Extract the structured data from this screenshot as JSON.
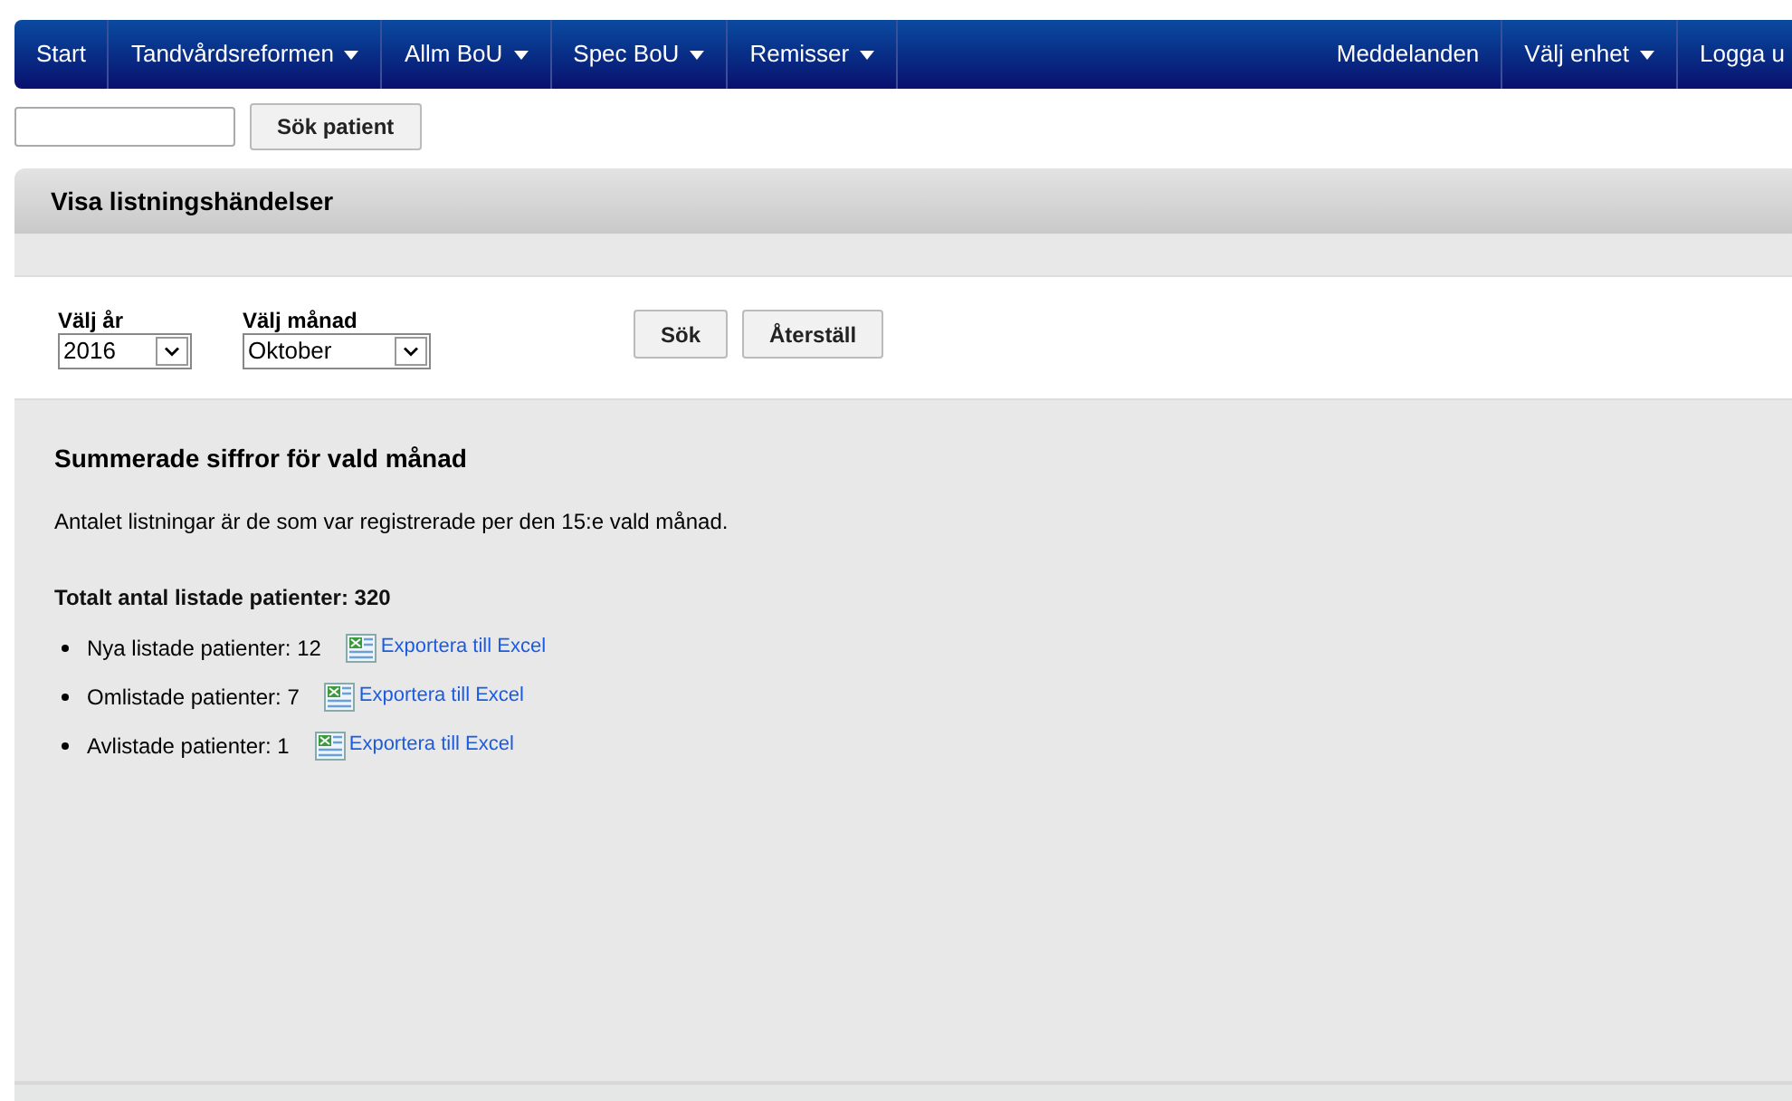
{
  "nav": {
    "left": [
      {
        "label": "Start",
        "dropdown": false
      },
      {
        "label": "Tandvårdsreformen",
        "dropdown": true
      },
      {
        "label": "Allm BoU",
        "dropdown": true
      },
      {
        "label": "Spec BoU",
        "dropdown": true
      },
      {
        "label": "Remisser",
        "dropdown": true
      }
    ],
    "right": [
      {
        "label": "Meddelanden",
        "dropdown": false
      },
      {
        "label": "Välj enhet",
        "dropdown": true
      },
      {
        "label": "Logga u",
        "dropdown": false
      }
    ]
  },
  "patient_search": {
    "button": "Sök patient"
  },
  "panel": {
    "title": "Visa listningshändelser",
    "filters": [
      {
        "label": "Välj år",
        "value": "2016"
      },
      {
        "label": "Välj månad",
        "value": "Oktober"
      }
    ],
    "buttons": [
      "Sök",
      "Återställ"
    ],
    "summary": {
      "heading": "Summerade siffror för vald månad",
      "note": "Antalet listningar är de som var registrerade per den 15:e vald månad.",
      "total": "Totalt antal listade patienter: 320",
      "items": [
        {
          "label": "Nya listade patienter: 12",
          "link": "Exportera till Excel"
        },
        {
          "label": "Omlistade patienter: 7",
          "link": "Exportera till Excel"
        },
        {
          "label": "Avlistade patienter: 1",
          "link": "Exportera till Excel"
        }
      ]
    }
  }
}
